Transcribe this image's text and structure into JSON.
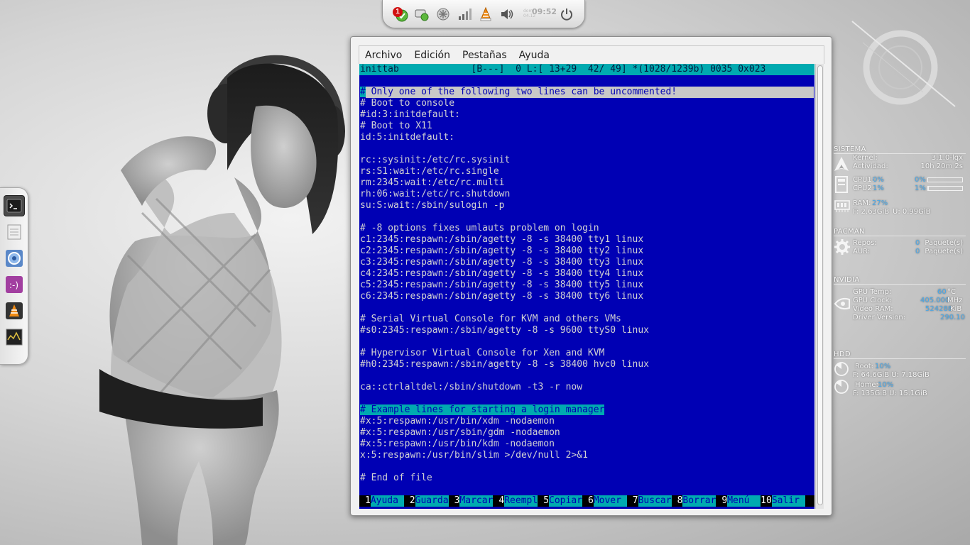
{
  "top_panel": {
    "notification_count": "1",
    "clock_time": "09:52",
    "clock_day": "dom\n04.12"
  },
  "dock": {
    "items": [
      "terminal-icon",
      "files-icon",
      "browser-icon",
      "chat-icon",
      "vlc-icon",
      "monitor-icon"
    ]
  },
  "terminal": {
    "menu": [
      "Archivo",
      "Edición",
      "Pestañas",
      "Ayuda"
    ],
    "status_line": "inittab             [B---]  0 L:[ 13+29  42/ 49] *(1028/1239b) 0035 0x023",
    "lines": [
      "",
      "# Only one of the following two lines can be uncommented!",
      "# Boot to console",
      "#id:3:initdefault:",
      "# Boot to X11",
      "id:5:initdefault:",
      "",
      "rc::sysinit:/etc/rc.sysinit",
      "rs:S1:wait:/etc/rc.single",
      "rm:2345:wait:/etc/rc.multi",
      "rh:06:wait:/etc/rc.shutdown",
      "su:S:wait:/sbin/sulogin -p",
      "",
      "# -8 options fixes umlauts problem on login",
      "c1:2345:respawn:/sbin/agetty -8 -s 38400 tty1 linux",
      "c2:2345:respawn:/sbin/agetty -8 -s 38400 tty2 linux",
      "c3:2345:respawn:/sbin/agetty -8 -s 38400 tty3 linux",
      "c4:2345:respawn:/sbin/agetty -8 -s 38400 tty4 linux",
      "c5:2345:respawn:/sbin/agetty -8 -s 38400 tty5 linux",
      "c6:2345:respawn:/sbin/agetty -8 -s 38400 tty6 linux",
      "",
      "# Serial Virtual Console for KVM and others VMs",
      "#s0:2345:respawn:/sbin/agetty -8 -s 9600 ttyS0 linux",
      "",
      "# Hypervisor Virtual Console for Xen and KVM",
      "#h0:2345:respawn:/sbin/agetty -8 -s 38400 hvc0 linux",
      "",
      "ca::ctrlaltdel:/sbin/shutdown -t3 -r now",
      "",
      "# Example lines for starting a login manager",
      "#x:5:respawn:/usr/bin/xdm -nodaemon",
      "#x:5:respawn:/usr/sbin/gdm -nodaemon",
      "#x:5:respawn:/usr/bin/kdm -nodaemon",
      "x:5:respawn:/usr/bin/slim >/dev/null 2>&1",
      "",
      "# End of file"
    ],
    "highlight_gray_line": 1,
    "highlight_cyan_line": 29,
    "fkeys": [
      {
        "num": "1",
        "label": "Ayuda "
      },
      {
        "num": "2",
        "label": "Guarda"
      },
      {
        "num": "3",
        "label": "Marcar"
      },
      {
        "num": "4",
        "label": "Reempl"
      },
      {
        "num": "5",
        "label": "Copiar"
      },
      {
        "num": "6",
        "label": "Mover "
      },
      {
        "num": "7",
        "label": "Buscar"
      },
      {
        "num": "8",
        "label": "Borrar"
      },
      {
        "num": "9",
        "label": "Menú  "
      },
      {
        "num": "10",
        "label": "Salir "
      }
    ]
  },
  "conky": {
    "sistema": {
      "title": "SISTEMA",
      "kernel_label": "Kernel:",
      "kernel_value": "3.1.0-lqx",
      "uptime_label": "Actividad:",
      "uptime_value": "10h 20m 2s",
      "cpu1_label": "CPU1:",
      "cpu1_value": "0%",
      "cpu2_label": "CPU2:",
      "cpu2_value": "1%",
      "cpu1_bar": 0.0,
      "cpu2_bar": 0.02,
      "ram_label": "RAM:",
      "ram_value": "27%",
      "ram_detail_f": "F: 2.63GiB",
      "ram_detail_u": "U: 0.99GiB"
    },
    "pacman": {
      "title": "PACMAN",
      "repos_label": "Repos:",
      "repos_value": "0",
      "repos_unit": "Paquete(s)",
      "aur_label": "AUR:",
      "aur_value": "0",
      "aur_unit": "Paquete(s)"
    },
    "nvidia": {
      "title": "NVIDIA",
      "temp_label": "GPU Temp:",
      "temp_value": "60",
      "temp_unit": "°C",
      "clock_label": "GPU Clock:",
      "clock_value": "405.000",
      "clock_unit": "MHz",
      "vram_label": "Video RAM:",
      "vram_value": "524288",
      "vram_unit": "KiB",
      "driver_label": "Driver Version:",
      "driver_value": "290.10"
    },
    "hdd": {
      "title": "HDD",
      "root_label": "Root:",
      "root_value": "10%",
      "root_detail": "F: 64.6GiB U: 7.18GiB",
      "home_label": "Home:",
      "home_value": "10%",
      "home_detail": "F: 135GiB U: 15.1GiB"
    }
  },
  "colors": {
    "terminal_bg": "#0000b4",
    "terminal_accent": "#00aab0",
    "conky_value": "#4aa8e8"
  }
}
